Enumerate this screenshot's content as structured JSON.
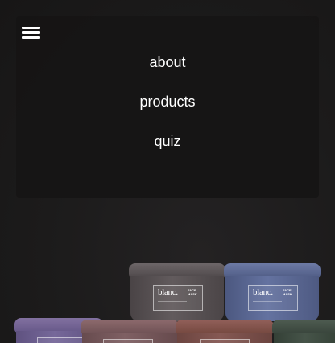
{
  "nav": {
    "links": [
      {
        "label": "about"
      },
      {
        "label": "products"
      },
      {
        "label": "quiz"
      }
    ]
  },
  "products": {
    "brand": "blanc.",
    "type_label": "FACE MASK",
    "colors": {
      "grey": "#5b5557",
      "blue": "#5a6791",
      "purple": "#6e5f86",
      "rose": "#7a5a5c",
      "terracotta": "#7d4e48",
      "green": "#3d4a40"
    }
  }
}
